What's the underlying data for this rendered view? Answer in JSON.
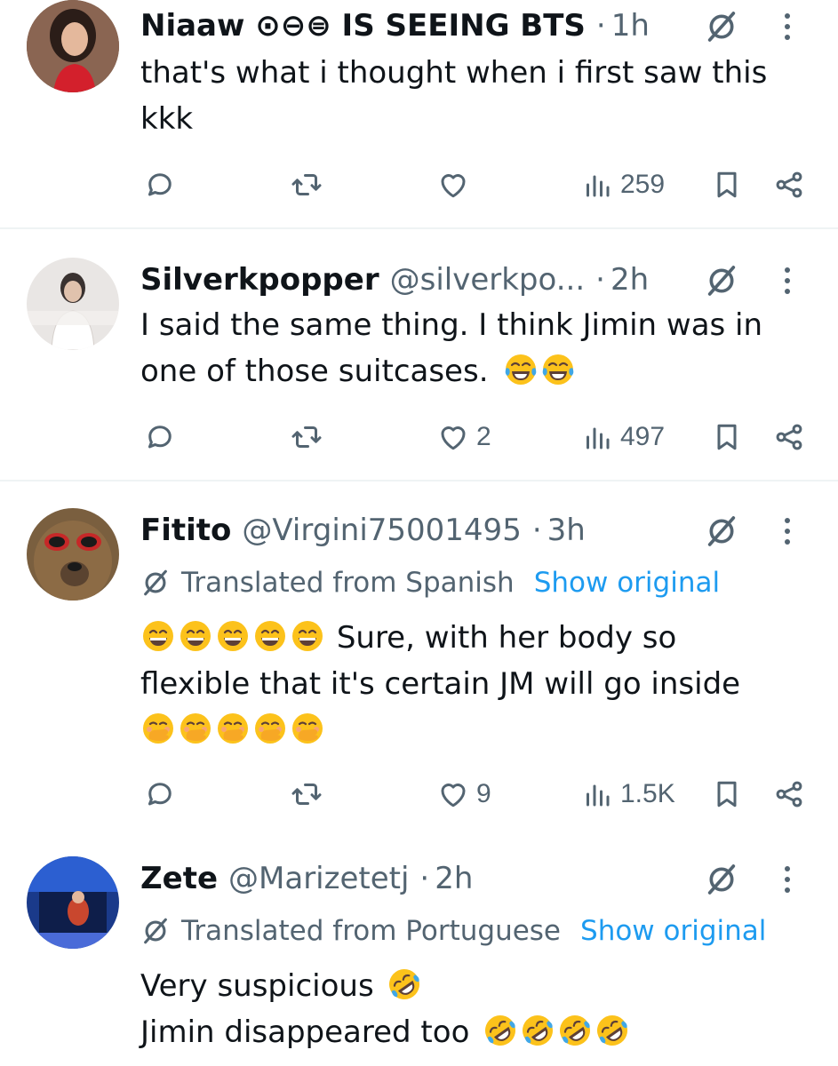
{
  "posts": [
    {
      "name": "Niaaw ⊙⊖⊜ IS SEEING BTS",
      "handle": "",
      "time": "1h",
      "translated": "",
      "show_original": "",
      "lines": [
        "that's what i thought when i first saw this",
        "kkk"
      ],
      "replies": "",
      "reposts": "",
      "likes": "",
      "views": "259"
    },
    {
      "name": "Silverkpopper",
      "handle": "@silverkpo...",
      "time": "2h",
      "lines": [
        "I said the same thing. I think Jimin was in",
        "one of those suitcases."
      ],
      "replies": "",
      "reposts": "",
      "likes": "2",
      "views": "497"
    },
    {
      "name": "Fitito",
      "handle": "@Virgini75001495",
      "time": "3h",
      "translated": "Translated from Spanish",
      "show_original": "Show original",
      "lines": [
        "Sure, with her body so",
        "flexible that it's certain JM will go inside"
      ],
      "replies": "",
      "reposts": "",
      "likes": "9",
      "views": "1.5K"
    },
    {
      "name": "Zete",
      "handle": "@Marizetetj",
      "time": "2h",
      "translated": "Translated from Portuguese",
      "show_original": "Show original",
      "lines": [
        "Very suspicious",
        "Jimin disappeared too"
      ]
    }
  ],
  "icons": {
    "reply": "reply-icon",
    "repost": "repost-icon",
    "like": "heart-icon",
    "views": "views-icon",
    "bookmark": "bookmark-icon",
    "share": "share-icon",
    "grok": "grok-icon",
    "more": "more-icon",
    "translate": "translate-icon"
  },
  "colors": {
    "text": "#0f1419",
    "secondary": "#536471",
    "link": "#1d9bf0",
    "divider": "#eff3f4"
  }
}
